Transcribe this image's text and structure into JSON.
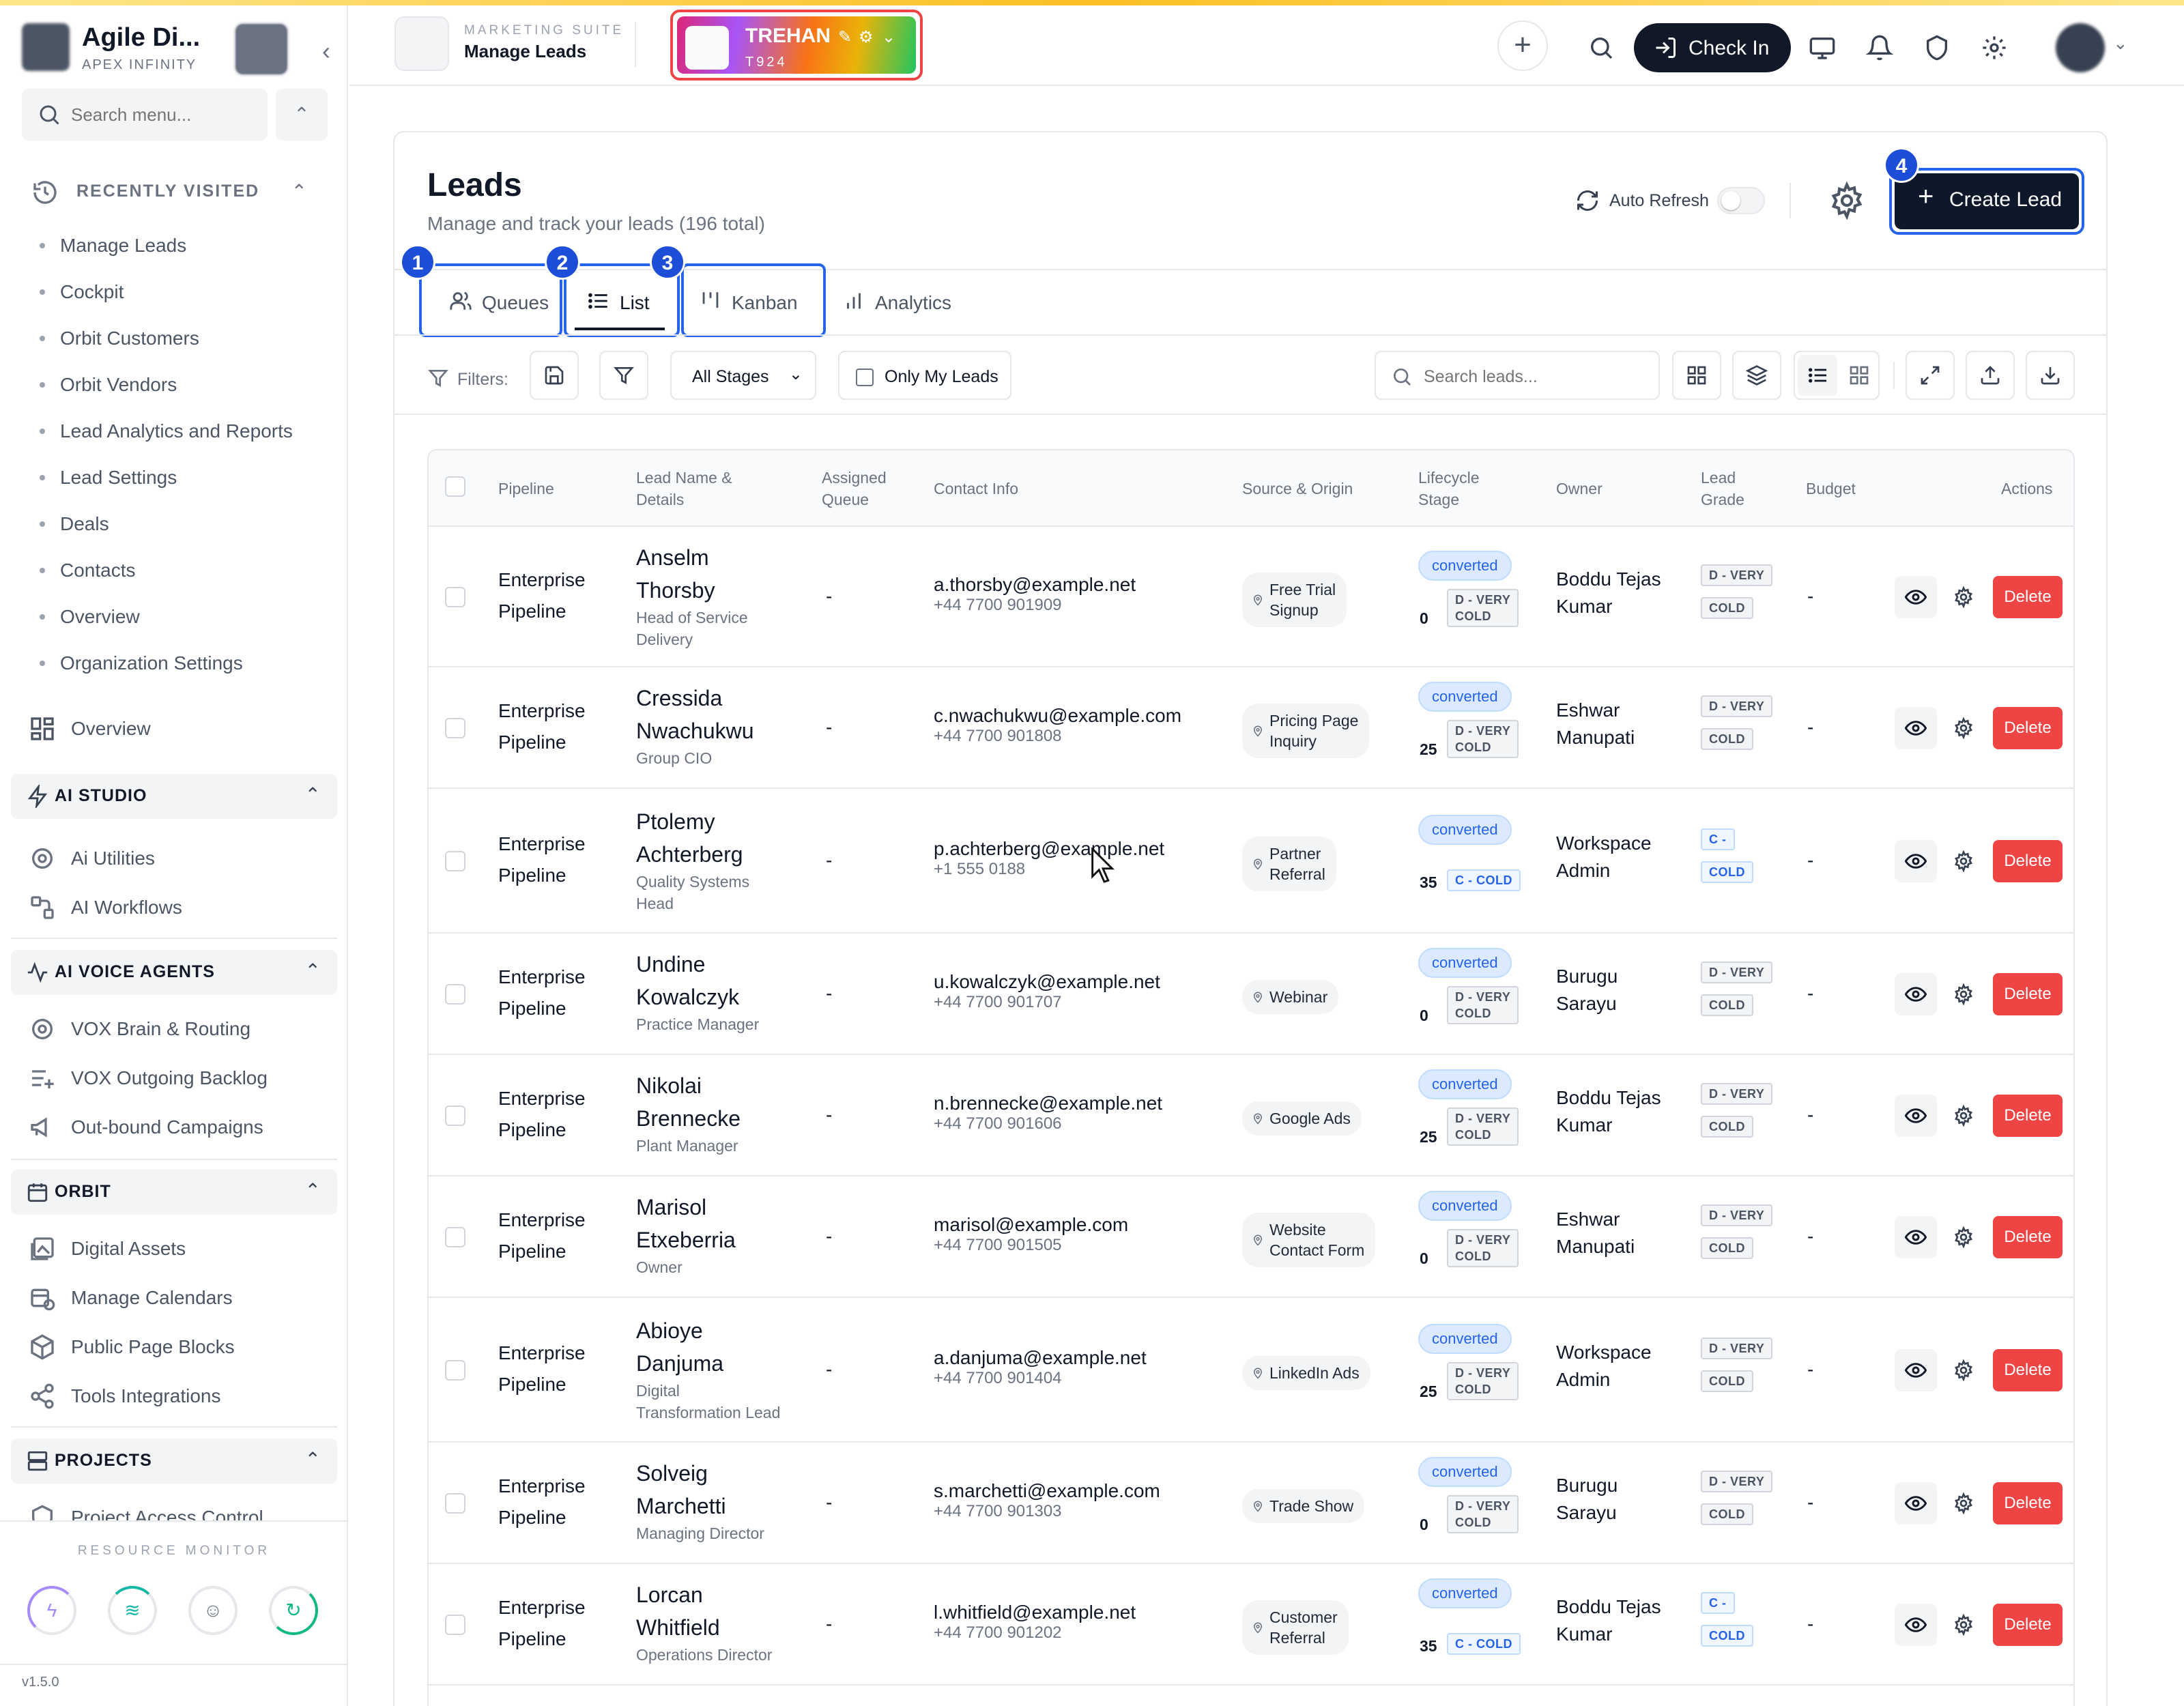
{
  "app": {
    "brand_name": "Agile Di...",
    "brand_sub": "APEX INFINITY",
    "suite_label": "MARKETING SUITE",
    "current_page": "Manage Leads",
    "tenant_name": "TREHAN",
    "tenant_code": "T924",
    "check_in_label": "Check In",
    "version": "v1.5.0"
  },
  "sidebar": {
    "search_placeholder": "Search menu...",
    "recently_visited_label": "RECENTLY VISITED",
    "recent": [
      "Manage Leads",
      "Cockpit",
      "Orbit Customers",
      "Orbit Vendors",
      "Lead Analytics and Reports",
      "Lead Settings",
      "Deals",
      "Contacts",
      "Overview",
      "Organization Settings"
    ],
    "overview_label": "Overview",
    "groups": {
      "ai_studio": {
        "label": "AI STUDIO",
        "items": [
          "Ai Utilities",
          "AI Workflows"
        ]
      },
      "ai_voice": {
        "label": "AI VOICE AGENTS",
        "items": [
          "VOX Brain & Routing",
          "VOX Outgoing Backlog",
          "Out-bound Campaigns"
        ]
      },
      "orbit": {
        "label": "ORBIT",
        "items": [
          "Digital Assets",
          "Manage Calendars",
          "Public Page Blocks",
          "Tools Integrations"
        ]
      },
      "projects": {
        "label": "PROJECTS",
        "items": [
          "Project Access Control"
        ]
      }
    },
    "resource_monitor_label": "RESOURCE MONITOR"
  },
  "page": {
    "title": "Leads",
    "subtitle": "Manage and track your leads (196 total)",
    "auto_refresh_label": "Auto Refresh",
    "auto_refresh_on": false,
    "create_label": "Create Lead",
    "badges": [
      "1",
      "2",
      "3",
      "4"
    ],
    "tabs": [
      "Queues",
      "List",
      "Kanban",
      "Analytics"
    ],
    "active_tab": "List",
    "filters_label": "Filters:",
    "stage_select": "All Stages",
    "only_my_leads_label": "Only My Leads",
    "search_placeholder": "Search leads..."
  },
  "table": {
    "headers": {
      "pipeline": "Pipeline",
      "lead_name_1": "Lead Name &",
      "lead_name_2": "Details",
      "queue_1": "Assigned",
      "queue_2": "Queue",
      "contact": "Contact Info",
      "source": "Source & Origin",
      "lifecycle_1": "Lifecycle",
      "lifecycle_2": "Stage",
      "owner": "Owner",
      "grade_1": "Lead",
      "grade_2": "Grade",
      "budget": "Budget",
      "actions": "Actions"
    },
    "delete_label": "Delete",
    "rows": [
      {
        "pipeline1": "Enterprise",
        "pipeline2": "Pipeline",
        "name1": "Anselm",
        "name2": "Thorsby",
        "role1": "Head of Service",
        "role2": "Delivery",
        "queue": "-",
        "email": "a.thorsby@example.net",
        "phone": "+44 7700 901909",
        "src1": "Free Trial",
        "src2": "Signup",
        "stage": "converted",
        "score": "0",
        "tag1": "D - VERY",
        "tag2": "COLD",
        "owner1": "Boddu Tejas",
        "owner2": "Kumar",
        "grade1": "D - VERY",
        "grade2": "COLD",
        "budget": "-"
      },
      {
        "pipeline1": "Enterprise",
        "pipeline2": "Pipeline",
        "name1": "Cressida",
        "name2": "Nwachukwu",
        "role1": "Group CIO",
        "role2": "",
        "queue": "-",
        "email": "c.nwachukwu@example.com",
        "phone": "+44 7700 901808",
        "src1": "Pricing Page",
        "src2": "Inquiry",
        "stage": "converted",
        "score": "25",
        "tag1": "D - VERY",
        "tag2": "COLD",
        "owner1": "Eshwar",
        "owner2": "Manupati",
        "grade1": "D - VERY",
        "grade2": "COLD",
        "budget": "-"
      },
      {
        "pipeline1": "Enterprise",
        "pipeline2": "Pipeline",
        "name1": "Ptolemy",
        "name2": "Achterberg",
        "role1": "Quality Systems",
        "role2": "Head",
        "queue": "-",
        "email": "p.achterberg@example.net",
        "phone": "+1 555 0188",
        "src1": "Partner",
        "src2": "Referral",
        "stage": "converted",
        "score": "35",
        "tag1": "C - COLD",
        "tag2": "",
        "owner1": "Workspace",
        "owner2": "Admin",
        "grade1": "C -",
        "grade2": "COLD",
        "budget": "-"
      },
      {
        "pipeline1": "Enterprise",
        "pipeline2": "Pipeline",
        "name1": "Undine",
        "name2": "Kowalczyk",
        "role1": "Practice Manager",
        "role2": "",
        "queue": "-",
        "email": "u.kowalczyk@example.net",
        "phone": "+44 7700 901707",
        "src1": "Webinar",
        "src2": "",
        "stage": "converted",
        "score": "0",
        "tag1": "D - VERY",
        "tag2": "COLD",
        "owner1": "Burugu",
        "owner2": "Sarayu",
        "grade1": "D - VERY",
        "grade2": "COLD",
        "budget": "-"
      },
      {
        "pipeline1": "Enterprise",
        "pipeline2": "Pipeline",
        "name1": "Nikolai",
        "name2": "Brennecke",
        "role1": "Plant Manager",
        "role2": "",
        "queue": "-",
        "email": "n.brennecke@example.net",
        "phone": "+44 7700 901606",
        "src1": "Google Ads",
        "src2": "",
        "stage": "converted",
        "score": "25",
        "tag1": "D - VERY",
        "tag2": "COLD",
        "owner1": "Boddu Tejas",
        "owner2": "Kumar",
        "grade1": "D - VERY",
        "grade2": "COLD",
        "budget": "-"
      },
      {
        "pipeline1": "Enterprise",
        "pipeline2": "Pipeline",
        "name1": "Marisol",
        "name2": "Etxeberria",
        "role1": "Owner",
        "role2": "",
        "queue": "-",
        "email": "marisol@example.com",
        "phone": "+44 7700 901505",
        "src1": "Website",
        "src2": "Contact Form",
        "stage": "converted",
        "score": "0",
        "tag1": "D - VERY",
        "tag2": "COLD",
        "owner1": "Eshwar",
        "owner2": "Manupati",
        "grade1": "D - VERY",
        "grade2": "COLD",
        "budget": "-"
      },
      {
        "pipeline1": "Enterprise",
        "pipeline2": "Pipeline",
        "name1": "Abioye",
        "name2": "Danjuma",
        "role1": "Digital",
        "role2": "Transformation Lead",
        "queue": "-",
        "email": "a.danjuma@example.net",
        "phone": "+44 7700 901404",
        "src1": "LinkedIn Ads",
        "src2": "",
        "stage": "converted",
        "score": "25",
        "tag1": "D - VERY",
        "tag2": "COLD",
        "owner1": "Workspace",
        "owner2": "Admin",
        "grade1": "D - VERY",
        "grade2": "COLD",
        "budget": "-"
      },
      {
        "pipeline1": "Enterprise",
        "pipeline2": "Pipeline",
        "name1": "Solveig",
        "name2": "Marchetti",
        "role1": "Managing Director",
        "role2": "",
        "queue": "-",
        "email": "s.marchetti@example.com",
        "phone": "+44 7700 901303",
        "src1": "Trade Show",
        "src2": "",
        "stage": "converted",
        "score": "0",
        "tag1": "D - VERY",
        "tag2": "COLD",
        "owner1": "Burugu",
        "owner2": "Sarayu",
        "grade1": "D - VERY",
        "grade2": "COLD",
        "budget": "-"
      },
      {
        "pipeline1": "Enterprise",
        "pipeline2": "Pipeline",
        "name1": "Lorcan",
        "name2": "Whitfield",
        "role1": "Operations Director",
        "role2": "",
        "queue": "-",
        "email": "l.whitfield@example.net",
        "phone": "+44 7700 901202",
        "src1": "Customer",
        "src2": "Referral",
        "stage": "converted",
        "score": "35",
        "tag1": "C - COLD",
        "tag2": "",
        "owner1": "Boddu Tejas",
        "owner2": "Kumar",
        "grade1": "C -",
        "grade2": "COLD",
        "budget": "-"
      }
    ]
  },
  "icons": {
    "search": "search-icon",
    "history": "history-icon",
    "grid": "grid-icon",
    "bell": "bell-icon",
    "shield": "shield-icon",
    "gear": "gear-icon",
    "monitor": "monitor-icon",
    "refresh": "refresh-icon",
    "filter": "filter-icon"
  },
  "colors": {
    "accent": "#2563eb",
    "danger": "#ef4444",
    "dark": "#0f172a",
    "stage_chip": "#dbeafe"
  }
}
